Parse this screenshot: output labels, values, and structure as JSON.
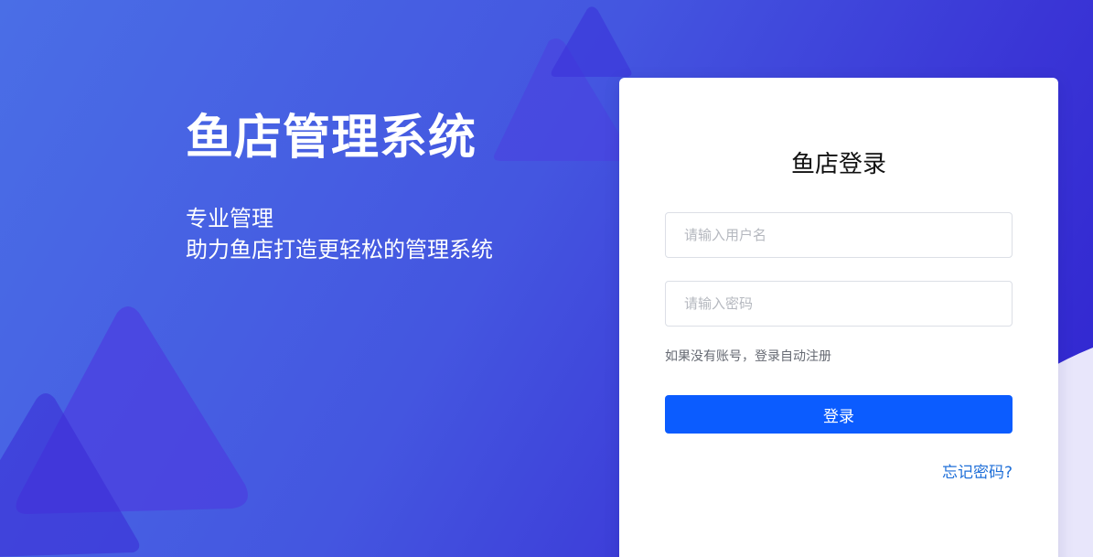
{
  "hero": {
    "title": "鱼店管理系统",
    "subtitle_line1": "专业管理",
    "subtitle_line2": "助力鱼店打造更轻松的管理系统"
  },
  "login": {
    "title": "鱼店登录",
    "username_placeholder": "请输入用户名",
    "password_placeholder": "请输入密码",
    "hint": "如果没有账号，登录自动注册",
    "submit_label": "登录",
    "forgot_label": "忘记密码?"
  },
  "colors": {
    "primary": "#0b5cff",
    "link": "#1f6fd8",
    "background_start": "#4a6ee6",
    "background_end": "#2f23cf"
  }
}
